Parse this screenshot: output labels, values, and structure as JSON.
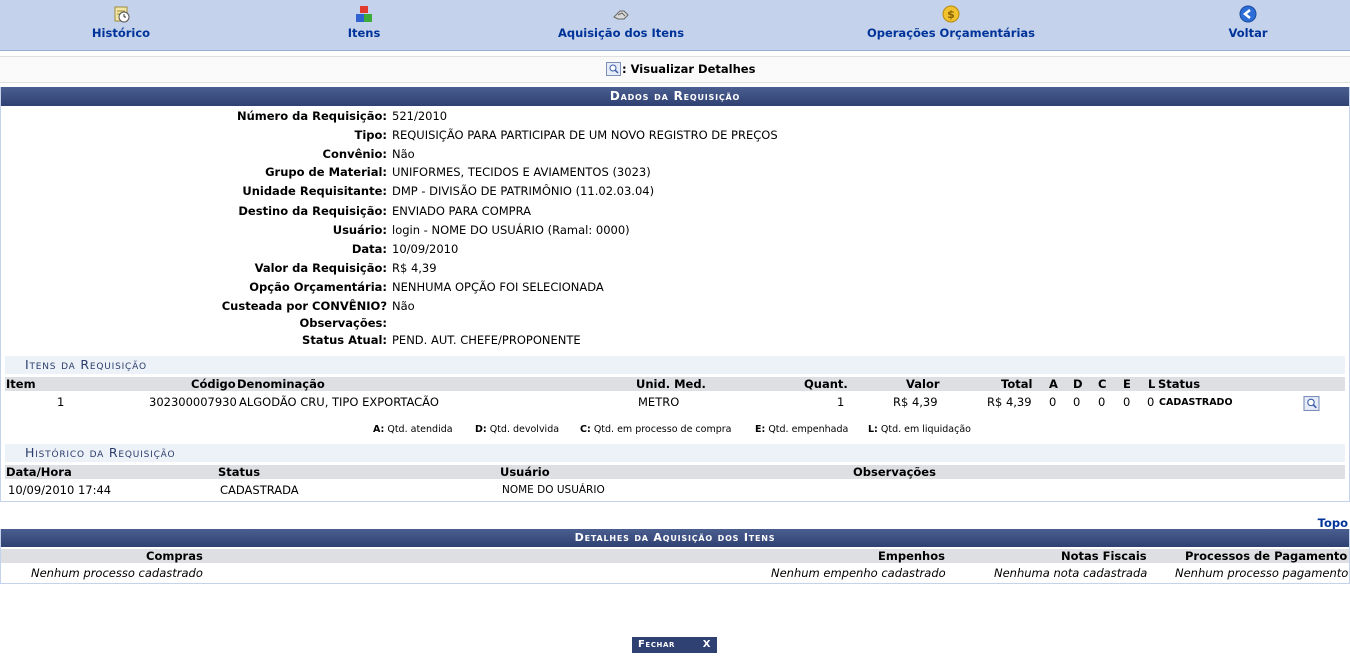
{
  "nav": [
    {
      "label": "Histórico",
      "icon": "clock-document-icon"
    },
    {
      "label": "Itens",
      "icon": "cubes-icon"
    },
    {
      "label": "Aquisição dos Itens",
      "icon": "handshake-icon"
    },
    {
      "label": "Operações Orçamentárias",
      "icon": "coin-icon"
    },
    {
      "label": "Voltar",
      "icon": "back-arrow-icon"
    }
  ],
  "legend": {
    "label": ": Visualizar Detalhes",
    "icon": "magnifier-icon"
  },
  "dados": {
    "caption": "Dados da Requisição",
    "fields": [
      {
        "label": "Número da Requisição:",
        "value": "521/2010"
      },
      {
        "label": "Tipo:",
        "value": "REQUISIÇÃO PARA PARTICIPAR DE UM NOVO REGISTRO DE PREÇOS"
      },
      {
        "label": "Convênio:",
        "value": "Não"
      },
      {
        "label": "Grupo de Material:",
        "value": "UNIFORMES, TECIDOS E AVIAMENTOS (3023)"
      },
      {
        "label": "Unidade Requisitante:",
        "value": "DMP - DIVISÃO DE PATRIMÔNIO (11.02.03.04)"
      },
      {
        "label": "Destino da Requisição:",
        "value": "ENVIADO PARA COMPRA"
      },
      {
        "label": "Usuário:",
        "value": "login - NOME DO USUÁRIO (Ramal: 0000)"
      },
      {
        "label": "Data:",
        "value": "10/09/2010"
      },
      {
        "label": "Valor da Requisição:",
        "value": "R$ 4,39"
      },
      {
        "label": "Opção Orçamentária:",
        "value": "NENHUMA OPÇÃO FOI SELECIONADA"
      },
      {
        "label": "Custeada por CONVÊNIO?",
        "value": "Não"
      },
      {
        "label": "Observações:",
        "value": ""
      },
      {
        "label": "Status Atual:",
        "value": "PEND. AUT. CHEFE/PROPONENTE"
      }
    ]
  },
  "itens": {
    "caption": "Itens da Requisição",
    "headers": {
      "item": "Item",
      "codigo": "Código",
      "denominacao": "Denominação",
      "unid": "Unid. Med.",
      "quant": "Quant.",
      "valor": "Valor",
      "total": "Total",
      "a": "A",
      "d": "D",
      "c": "C",
      "e": "E",
      "l": "L",
      "status": "Status"
    },
    "rows": [
      {
        "item": "1",
        "codigo": "302300007930",
        "denominacao": "ALGODÃO CRU, TIPO EXPORTACÃO",
        "unid": "METRO",
        "quant": "1",
        "valor": "R$ 4,39",
        "total": "R$ 4,39",
        "a": "0",
        "d": "0",
        "c": "0",
        "e": "0",
        "l": "0",
        "status": "CADASTRADO"
      }
    ],
    "legend": [
      {
        "k": "A:",
        "v": "Qtd. atendida"
      },
      {
        "k": "D:",
        "v": "Qtd. devolvida"
      },
      {
        "k": "C:",
        "v": "Qtd. em processo de compra"
      },
      {
        "k": "E:",
        "v": "Qtd. empenhada"
      },
      {
        "k": "L:",
        "v": "Qtd. em liquidação"
      }
    ]
  },
  "historico": {
    "caption": "Histórico da Requisição",
    "headers": {
      "data": "Data/Hora",
      "status": "Status",
      "usuario": "Usuário",
      "obs": "Observações"
    },
    "rows": [
      {
        "data": "10/09/2010 17:44",
        "status": "CADASTRADA",
        "usuario": "NOME DO USUÁRIO",
        "obs": ""
      }
    ]
  },
  "topo": "Topo",
  "aquisicao": {
    "caption": "Detalhes da Aquisição dos Itens",
    "headers": {
      "compras": "Compras",
      "empenhos": "Empenhos",
      "notas": "Notas Fiscais",
      "processos": "Processos de Pagamento"
    },
    "row": {
      "compras": "Nenhum processo cadastrado",
      "empenhos": "Nenhum empenho cadastrado",
      "notas": "Nenhuma nota cadastrada",
      "processos": "Nenhum processo pagamento"
    }
  },
  "fechar": {
    "label": "Fechar",
    "x": "X"
  },
  "colors": {
    "nav_bg": "#C4D2EB",
    "caption_bg": "#2F4172",
    "link": "#003399",
    "subcap_bg": "#EDF1F8",
    "thead_bg": "#DEDFE3"
  }
}
